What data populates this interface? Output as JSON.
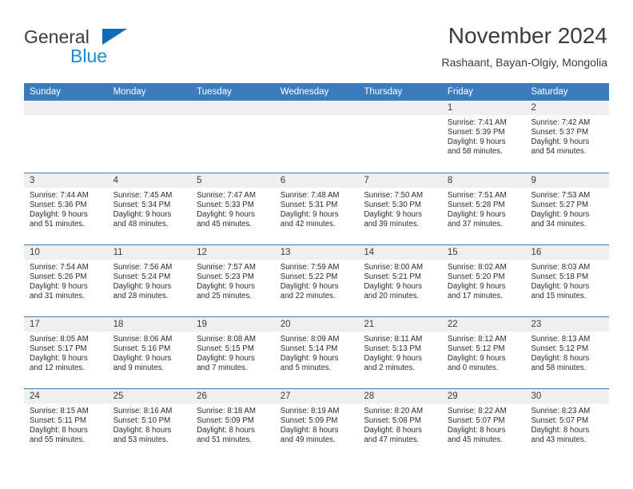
{
  "brand": {
    "line1": "General",
    "line2": "Blue",
    "triangle_color": "#0f6cb6",
    "blue_text_color": "#1e8bd4"
  },
  "header": {
    "title": "November 2024",
    "subtitle": "Rashaant, Bayan-Olgiy, Mongolia"
  },
  "colors": {
    "header_band": "#3a7cbe",
    "date_band": "#efefef",
    "row_divider": "#3a7cbe",
    "text": "#3b3b3b"
  },
  "weekdays": [
    "Sunday",
    "Monday",
    "Tuesday",
    "Wednesday",
    "Thursday",
    "Friday",
    "Saturday"
  ],
  "weeks": [
    [
      {
        "date": "",
        "lines": []
      },
      {
        "date": "",
        "lines": []
      },
      {
        "date": "",
        "lines": []
      },
      {
        "date": "",
        "lines": []
      },
      {
        "date": "",
        "lines": []
      },
      {
        "date": "1",
        "lines": [
          "Sunrise: 7:41 AM",
          "Sunset: 5:39 PM",
          "Daylight: 9 hours",
          "and 58 minutes."
        ]
      },
      {
        "date": "2",
        "lines": [
          "Sunrise: 7:42 AM",
          "Sunset: 5:37 PM",
          "Daylight: 9 hours",
          "and 54 minutes."
        ]
      }
    ],
    [
      {
        "date": "3",
        "lines": [
          "Sunrise: 7:44 AM",
          "Sunset: 5:36 PM",
          "Daylight: 9 hours",
          "and 51 minutes."
        ]
      },
      {
        "date": "4",
        "lines": [
          "Sunrise: 7:45 AM",
          "Sunset: 5:34 PM",
          "Daylight: 9 hours",
          "and 48 minutes."
        ]
      },
      {
        "date": "5",
        "lines": [
          "Sunrise: 7:47 AM",
          "Sunset: 5:33 PM",
          "Daylight: 9 hours",
          "and 45 minutes."
        ]
      },
      {
        "date": "6",
        "lines": [
          "Sunrise: 7:48 AM",
          "Sunset: 5:31 PM",
          "Daylight: 9 hours",
          "and 42 minutes."
        ]
      },
      {
        "date": "7",
        "lines": [
          "Sunrise: 7:50 AM",
          "Sunset: 5:30 PM",
          "Daylight: 9 hours",
          "and 39 minutes."
        ]
      },
      {
        "date": "8",
        "lines": [
          "Sunrise: 7:51 AM",
          "Sunset: 5:28 PM",
          "Daylight: 9 hours",
          "and 37 minutes."
        ]
      },
      {
        "date": "9",
        "lines": [
          "Sunrise: 7:53 AM",
          "Sunset: 5:27 PM",
          "Daylight: 9 hours",
          "and 34 minutes."
        ]
      }
    ],
    [
      {
        "date": "10",
        "lines": [
          "Sunrise: 7:54 AM",
          "Sunset: 5:26 PM",
          "Daylight: 9 hours",
          "and 31 minutes."
        ]
      },
      {
        "date": "11",
        "lines": [
          "Sunrise: 7:56 AM",
          "Sunset: 5:24 PM",
          "Daylight: 9 hours",
          "and 28 minutes."
        ]
      },
      {
        "date": "12",
        "lines": [
          "Sunrise: 7:57 AM",
          "Sunset: 5:23 PM",
          "Daylight: 9 hours",
          "and 25 minutes."
        ]
      },
      {
        "date": "13",
        "lines": [
          "Sunrise: 7:59 AM",
          "Sunset: 5:22 PM",
          "Daylight: 9 hours",
          "and 22 minutes."
        ]
      },
      {
        "date": "14",
        "lines": [
          "Sunrise: 8:00 AM",
          "Sunset: 5:21 PM",
          "Daylight: 9 hours",
          "and 20 minutes."
        ]
      },
      {
        "date": "15",
        "lines": [
          "Sunrise: 8:02 AM",
          "Sunset: 5:20 PM",
          "Daylight: 9 hours",
          "and 17 minutes."
        ]
      },
      {
        "date": "16",
        "lines": [
          "Sunrise: 8:03 AM",
          "Sunset: 5:18 PM",
          "Daylight: 9 hours",
          "and 15 minutes."
        ]
      }
    ],
    [
      {
        "date": "17",
        "lines": [
          "Sunrise: 8:05 AM",
          "Sunset: 5:17 PM",
          "Daylight: 9 hours",
          "and 12 minutes."
        ]
      },
      {
        "date": "18",
        "lines": [
          "Sunrise: 8:06 AM",
          "Sunset: 5:16 PM",
          "Daylight: 9 hours",
          "and 9 minutes."
        ]
      },
      {
        "date": "19",
        "lines": [
          "Sunrise: 8:08 AM",
          "Sunset: 5:15 PM",
          "Daylight: 9 hours",
          "and 7 minutes."
        ]
      },
      {
        "date": "20",
        "lines": [
          "Sunrise: 8:09 AM",
          "Sunset: 5:14 PM",
          "Daylight: 9 hours",
          "and 5 minutes."
        ]
      },
      {
        "date": "21",
        "lines": [
          "Sunrise: 8:11 AM",
          "Sunset: 5:13 PM",
          "Daylight: 9 hours",
          "and 2 minutes."
        ]
      },
      {
        "date": "22",
        "lines": [
          "Sunrise: 8:12 AM",
          "Sunset: 5:12 PM",
          "Daylight: 9 hours",
          "and 0 minutes."
        ]
      },
      {
        "date": "23",
        "lines": [
          "Sunrise: 8:13 AM",
          "Sunset: 5:12 PM",
          "Daylight: 8 hours",
          "and 58 minutes."
        ]
      }
    ],
    [
      {
        "date": "24",
        "lines": [
          "Sunrise: 8:15 AM",
          "Sunset: 5:11 PM",
          "Daylight: 8 hours",
          "and 55 minutes."
        ]
      },
      {
        "date": "25",
        "lines": [
          "Sunrise: 8:16 AM",
          "Sunset: 5:10 PM",
          "Daylight: 8 hours",
          "and 53 minutes."
        ]
      },
      {
        "date": "26",
        "lines": [
          "Sunrise: 8:18 AM",
          "Sunset: 5:09 PM",
          "Daylight: 8 hours",
          "and 51 minutes."
        ]
      },
      {
        "date": "27",
        "lines": [
          "Sunrise: 8:19 AM",
          "Sunset: 5:09 PM",
          "Daylight: 8 hours",
          "and 49 minutes."
        ]
      },
      {
        "date": "28",
        "lines": [
          "Sunrise: 8:20 AM",
          "Sunset: 5:08 PM",
          "Daylight: 8 hours",
          "and 47 minutes."
        ]
      },
      {
        "date": "29",
        "lines": [
          "Sunrise: 8:22 AM",
          "Sunset: 5:07 PM",
          "Daylight: 8 hours",
          "and 45 minutes."
        ]
      },
      {
        "date": "30",
        "lines": [
          "Sunrise: 8:23 AM",
          "Sunset: 5:07 PM",
          "Daylight: 8 hours",
          "and 43 minutes."
        ]
      }
    ]
  ]
}
